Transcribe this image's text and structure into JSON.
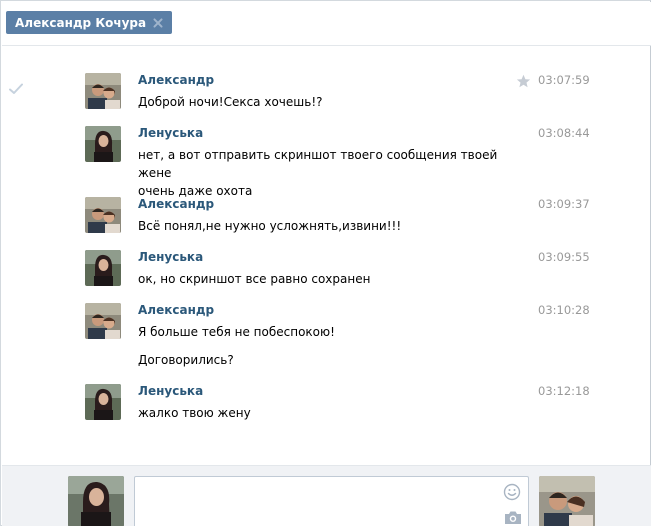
{
  "tab": {
    "title": "Александр Кочура"
  },
  "messages": [
    {
      "author": "Александр",
      "avatar": "man-woman-photo",
      "time": "03:07:59",
      "starred": true,
      "lines": [
        "Доброй ночи!Секса хочешь!?"
      ]
    },
    {
      "author": "Ленуська",
      "avatar": "woman-photo",
      "time": "03:08:44",
      "lines": [
        "нет, а вот отправить скриншот твоего сообщения твоей жене",
        "очень даже охота"
      ]
    },
    {
      "author": "Александр",
      "avatar": "man-woman-photo",
      "time": "03:09:37",
      "lines": [
        "Всё понял,не нужно усложнять,извини!!!"
      ]
    },
    {
      "author": "Ленуська",
      "avatar": "woman-photo",
      "time": "03:09:55",
      "lines": [
        "ок, но скриншот все равно сохранен"
      ]
    },
    {
      "author": "Александр",
      "avatar": "man-woman-photo",
      "time": "03:10:28",
      "lines": [
        "Я больше тебя не побеспокою!",
        "Договорились?"
      ]
    },
    {
      "author": "Ленуська",
      "avatar": "woman-photo",
      "time": "03:12:18",
      "lines": [
        "жалко твою жену"
      ]
    }
  ],
  "composer": {
    "value": ""
  },
  "colors": {
    "tab_bg": "#5b7fa6",
    "author": "#2b587a",
    "time": "#999999",
    "composer_bg": "#f0f2f5"
  }
}
